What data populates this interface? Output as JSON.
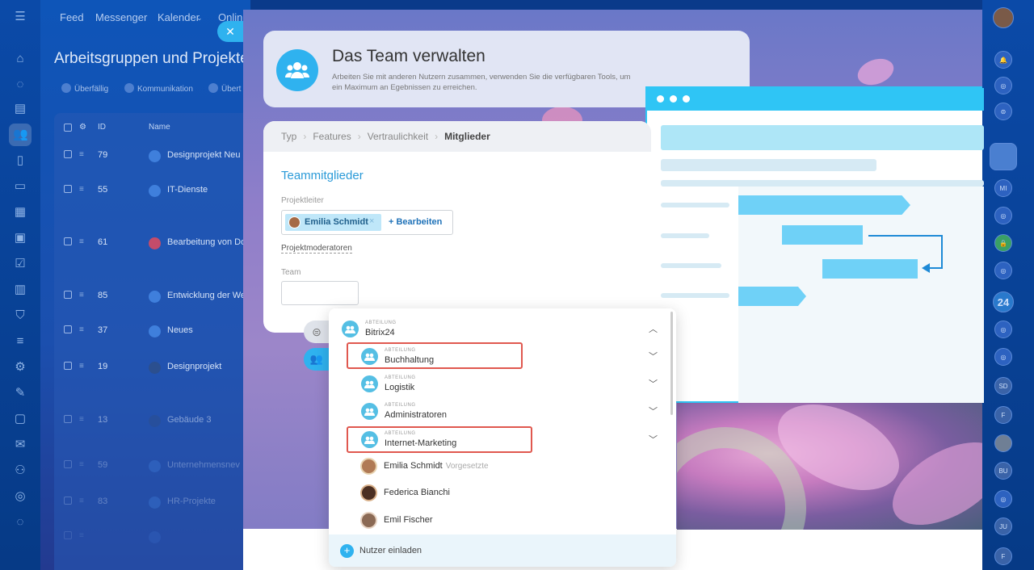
{
  "top_nav": [
    "Feed",
    "Messenger",
    "Kalender",
    "Online"
  ],
  "background_app": {
    "title": "Arbeitsgruppen und Projekte",
    "filters": [
      "Überfällig",
      "Kommunikation",
      "Übert"
    ],
    "columns": [
      "ID",
      "Name"
    ],
    "rows": [
      {
        "id": "79",
        "name": "Designprojekt Neu"
      },
      {
        "id": "55",
        "name": "IT-Dienste"
      },
      {
        "id": "61",
        "name": "Bearbeitung von Do"
      },
      {
        "id": "85",
        "name": "Entwicklung der We"
      },
      {
        "id": "37",
        "name": "Neues"
      },
      {
        "id": "19",
        "name": "Designprojekt"
      },
      {
        "id": "13",
        "name": "Gebäude 3"
      },
      {
        "id": "59",
        "name": "Unternehmensnev"
      },
      {
        "id": "83",
        "name": "HR-Projekte"
      },
      {
        "id": "",
        "name": ""
      }
    ]
  },
  "right_rail": {
    "badges": [
      "MI",
      "24",
      "SD",
      "F",
      "BU",
      "JU",
      "F"
    ]
  },
  "header": {
    "title": "Das Team verwalten",
    "subtitle": "Arbeiten Sie mit anderen Nutzern zusammen, verwenden Sie die verfügbaren Tools, um ein Maximum an Egebnissen zu erreichen."
  },
  "breadcrumbs": [
    "Typ",
    "Features",
    "Vertraulichkeit",
    "Mitglieder"
  ],
  "form": {
    "section_title": "Teammitglieder",
    "leader_label": "Projektleiter",
    "leader_name": "Emilia Schmidt",
    "edit_label": "+ Bearbeiten",
    "moderators_label": "Projektmoderatoren",
    "team_label": "Team"
  },
  "dropdown": {
    "root": {
      "caption": "ABTEILUNG",
      "name": "Bitrix24"
    },
    "departments": [
      {
        "caption": "ABTEILUNG",
        "name": "Buchhaltung",
        "highlighted": true
      },
      {
        "caption": "ABTEILUNG",
        "name": "Logistik",
        "highlighted": false
      },
      {
        "caption": "ABTEILUNG",
        "name": "Administratoren",
        "highlighted": false
      },
      {
        "caption": "ABTEILUNG",
        "name": "Internet-Marketing",
        "highlighted": true
      }
    ],
    "users": [
      {
        "name": "Emilia Schmidt",
        "role": "Vorgesetzte"
      },
      {
        "name": "Federica Bianchi",
        "role": ""
      },
      {
        "name": "Emil Fischer",
        "role": ""
      }
    ],
    "invite_label": "Nutzer einladen"
  },
  "colors": {
    "accent": "#2fb2ef",
    "highlight": "#e0584f",
    "link": "#1f72b8"
  }
}
